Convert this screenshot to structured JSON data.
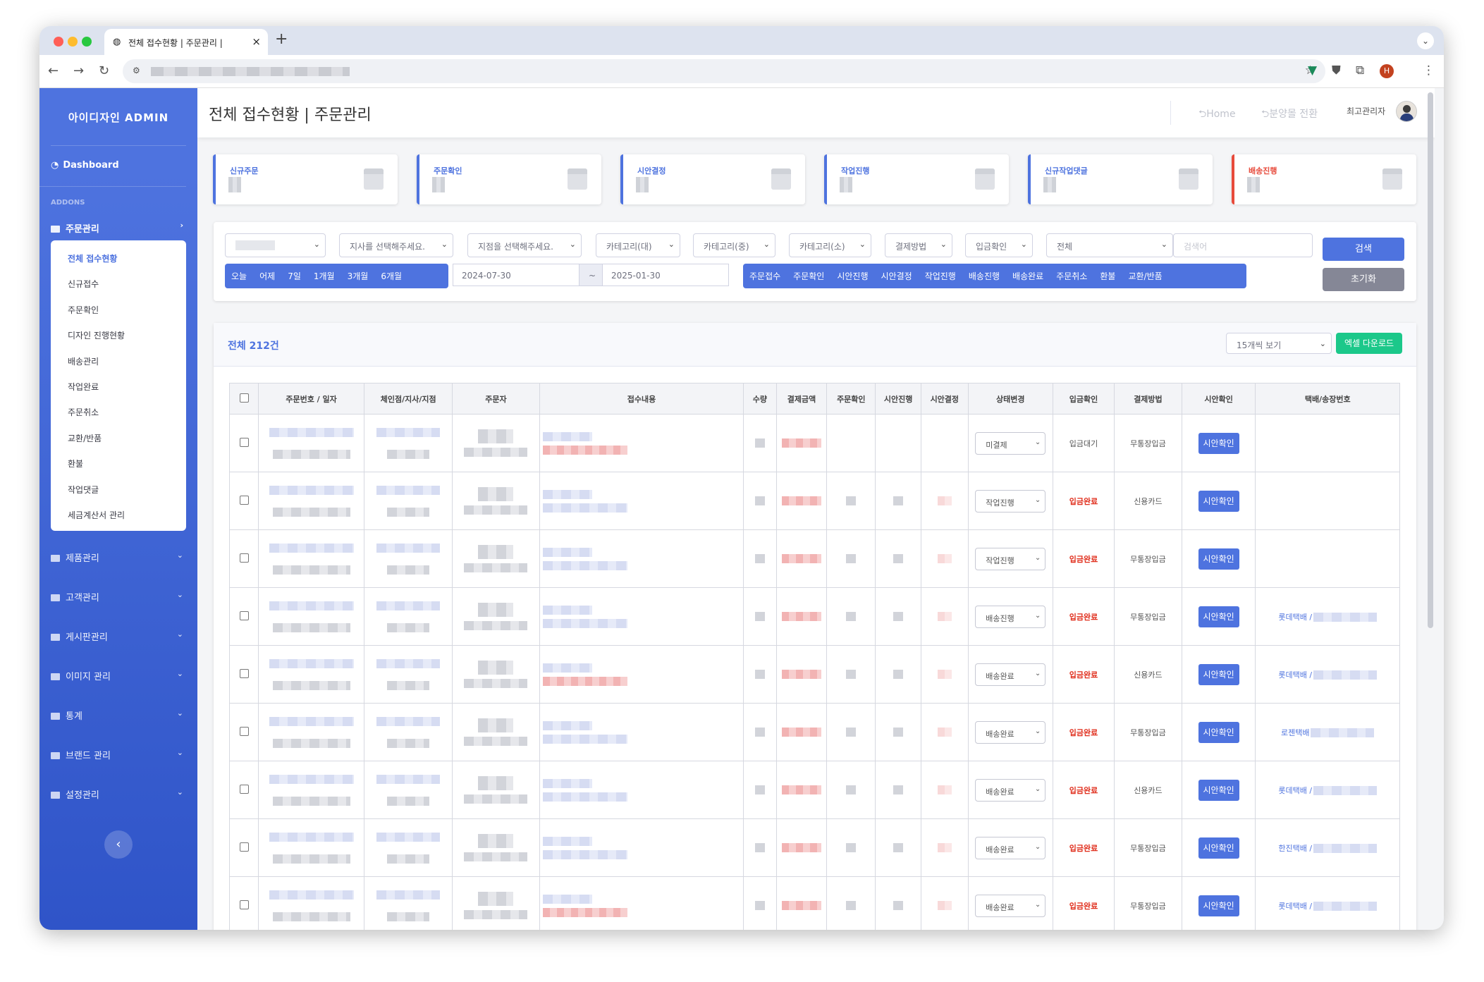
{
  "browser": {
    "tab_title": "전체 접수현황 | 주문관리 |",
    "new_tab": "+",
    "close": "×"
  },
  "sidebar": {
    "brand": "아이디자인 ADMIN",
    "dashboard": "Dashboard",
    "section": "ADDONS",
    "active_group": "주문관리",
    "sub_items": [
      "전체 접수현황",
      "신규접수",
      "주문확인",
      "디자인 진행현황",
      "배송관리",
      "작업완료",
      "주문취소",
      "교환/반품",
      "환불",
      "작업댓글",
      "세금계산서 관리"
    ],
    "groups": [
      "제품관리",
      "고객관리",
      "게시판관리",
      "이미지 관리",
      "통계",
      "브랜드 관리",
      "설정관리"
    ],
    "toggle": "‹"
  },
  "topbar": {
    "title": "전체 접수현황 | 주문관리",
    "home": "Home",
    "switch": "분양몰 전환",
    "user": "최고관리자"
  },
  "cards": [
    {
      "label": "신규주문"
    },
    {
      "label": "주문확인"
    },
    {
      "label": "시안결정"
    },
    {
      "label": "작업진행"
    },
    {
      "label": "신규작업댓글"
    },
    {
      "label": "배송진행"
    }
  ],
  "filters": {
    "selects": [
      "지사를 선택해주세요.",
      "지점을 선택해주세요.",
      "카테고리(대)",
      "카테고리(중)",
      "카테고리(소)",
      "결제방법",
      "입금확인",
      "전체"
    ],
    "search_placeholder": "검색어",
    "ranges": [
      "오늘",
      "어제",
      "7일",
      "1개월",
      "3개월",
      "6개월"
    ],
    "date_from": "2024-07-30",
    "date_sep": "~",
    "date_to": "2025-01-30",
    "status_buttons": [
      "주문접수",
      "주문확인",
      "시안진행",
      "시안결정",
      "작업진행",
      "배송진행",
      "배송완료",
      "주문취소",
      "환불",
      "교환/반품"
    ],
    "search_btn": "검색",
    "reset_btn": "초기화"
  },
  "list": {
    "title": "전체 212건",
    "page_size": "15개씩 보기",
    "excel": "엑셀 다운로드",
    "headers": [
      "주문번호 / 일자",
      "체인점/지사/지점",
      "주문자",
      "접수내용",
      "수량",
      "결제금액",
      "주문확인",
      "시안진행",
      "시안결정",
      "상태변경",
      "입금확인",
      "결제방법",
      "시안확인",
      "택배/송장번호"
    ],
    "rows": [
      {
        "status": "미결제",
        "deposit": "입금대기",
        "paid": false,
        "method": "무통장입금",
        "confirm": "시안확인",
        "courier": ""
      },
      {
        "status": "작업진행",
        "deposit": "입금완료",
        "paid": true,
        "method": "신용카드",
        "confirm": "시안확인",
        "courier": ""
      },
      {
        "status": "작업진행",
        "deposit": "입금완료",
        "paid": true,
        "method": "무통장입금",
        "confirm": "시안확인",
        "courier": ""
      },
      {
        "status": "배송진행",
        "deposit": "입금완료",
        "paid": true,
        "method": "무통장입금",
        "confirm": "시안확인",
        "courier": "롯데택배 /"
      },
      {
        "status": "배송완료",
        "deposit": "입금완료",
        "paid": true,
        "method": "신용카드",
        "confirm": "시안확인",
        "courier": "롯데택배 /"
      },
      {
        "status": "배송완료",
        "deposit": "입금완료",
        "paid": true,
        "method": "무통장입금",
        "confirm": "시안확인",
        "courier": "로젠택배"
      },
      {
        "status": "배송완료",
        "deposit": "입금완료",
        "paid": true,
        "method": "신용카드",
        "confirm": "시안확인",
        "courier": "롯데택배 /"
      },
      {
        "status": "배송완료",
        "deposit": "입금완료",
        "paid": true,
        "method": "무통장입금",
        "confirm": "시안확인",
        "courier": "한진택배 /"
      },
      {
        "status": "배송완료",
        "deposit": "입금완료",
        "paid": true,
        "method": "무통장입금",
        "confirm": "시안확인",
        "courier": "롯데택배 /"
      }
    ]
  }
}
